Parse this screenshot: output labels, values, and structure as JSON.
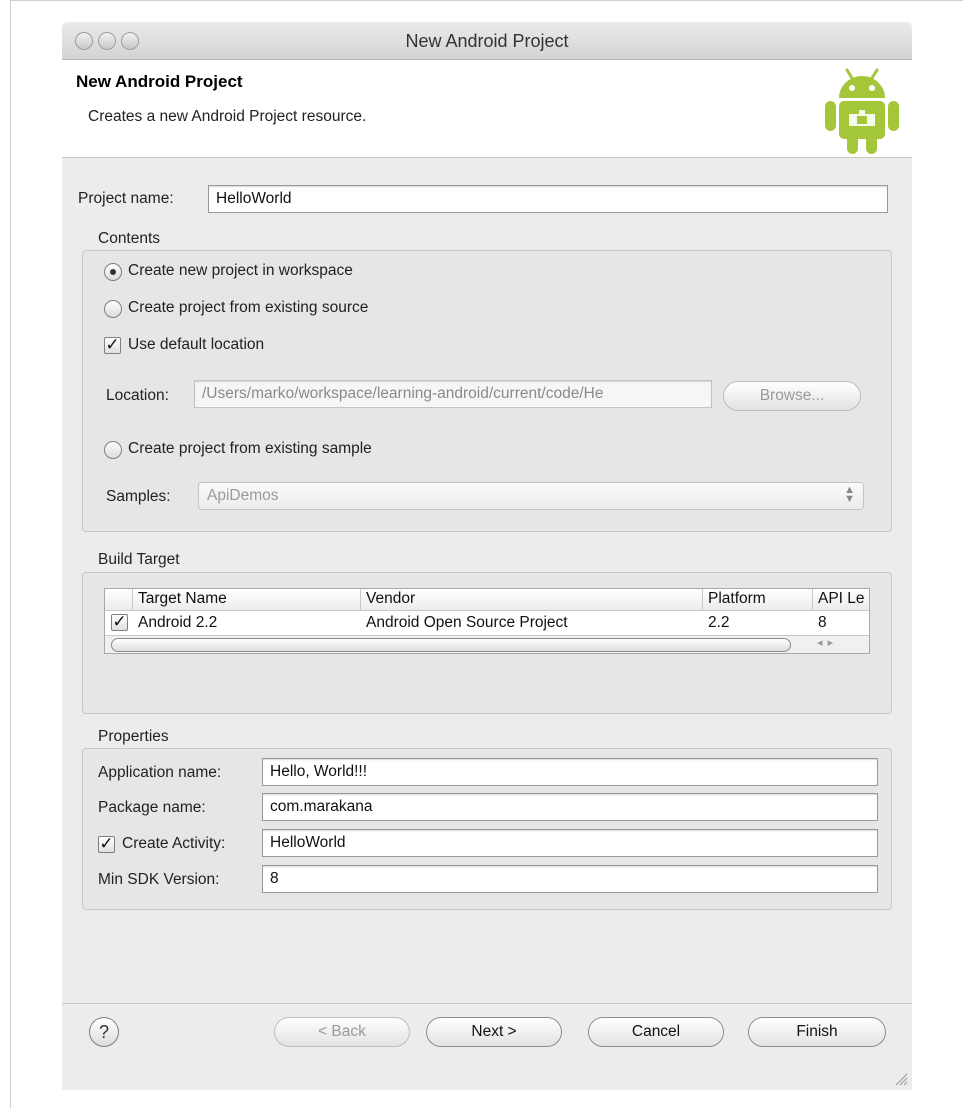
{
  "window": {
    "title": "New Android Project"
  },
  "banner": {
    "title": "New Android Project",
    "description": "Creates a new Android Project resource."
  },
  "project_name": {
    "label": "Project name:",
    "value": "HelloWorld"
  },
  "contents": {
    "group_label": "Contents",
    "radio_new": "Create new project in workspace",
    "radio_existing_source": "Create project from existing source",
    "use_default_location": "Use default location",
    "location_label": "Location:",
    "location_value": "/Users/marko/workspace/learning-android/current/code/He",
    "browse_button": "Browse...",
    "radio_existing_sample": "Create project from existing sample",
    "samples_label": "Samples:",
    "samples_value": "ApiDemos"
  },
  "build_target": {
    "group_label": "Build Target",
    "columns": [
      "Target Name",
      "Vendor",
      "Platform",
      "API Le"
    ],
    "rows": [
      {
        "checked": true,
        "cells": [
          "Android 2.2",
          "Android Open Source Project",
          "2.2",
          "8"
        ]
      }
    ]
  },
  "properties": {
    "group_label": "Properties",
    "app_name_label": "Application name:",
    "app_name_value": "Hello, World!!!",
    "package_label": "Package name:",
    "package_value": "com.marakana",
    "create_activity_label": "Create Activity:",
    "create_activity_value": "HelloWorld",
    "min_sdk_label": "Min SDK Version:",
    "min_sdk_value": "8"
  },
  "footer": {
    "help": "?",
    "back": "< Back",
    "next": "Next >",
    "cancel": "Cancel",
    "finish": "Finish"
  },
  "colors": {
    "android_green": "#a4c639"
  },
  "icons": [
    "android-robot-icon",
    "radio-selected-icon",
    "checkbox-checked-icon",
    "stepper-arrows-icon",
    "help-icon",
    "resize-grip-icon"
  ]
}
